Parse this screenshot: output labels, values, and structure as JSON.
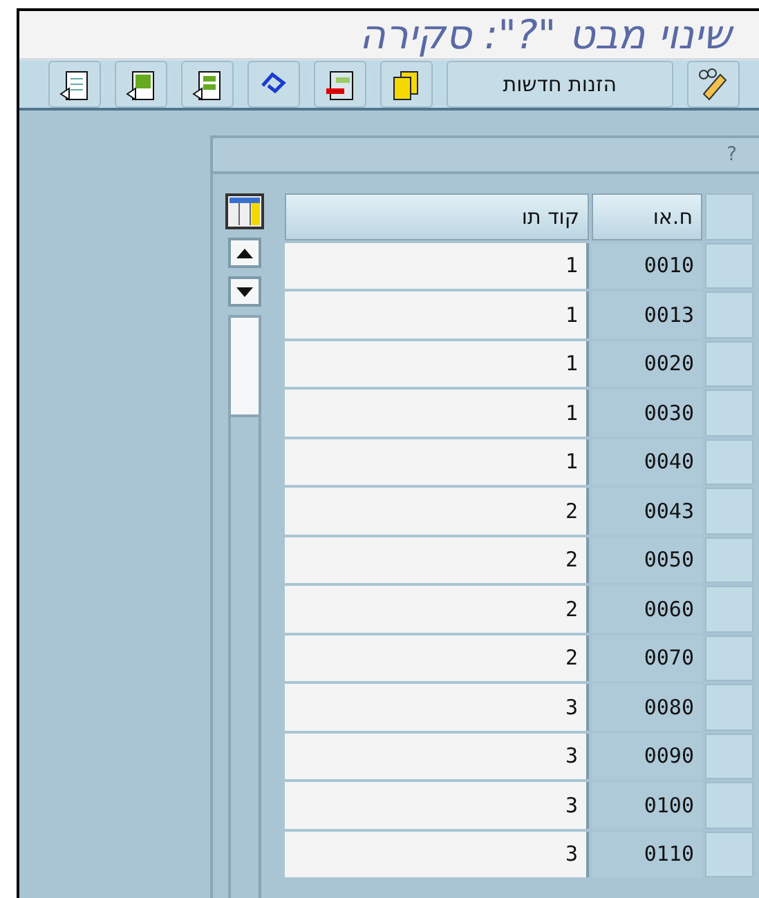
{
  "window": {
    "title": "שינוי מבט \"?\": סקירה"
  },
  "toolbar": [
    {
      "kind": "icon"
    },
    {
      "kind": "text",
      "label": "הזנות חדשות"
    },
    {
      "kind": "icon"
    },
    {
      "kind": "icon"
    },
    {
      "kind": "icon"
    },
    {
      "kind": "icon"
    },
    {
      "kind": "icon"
    },
    {
      "kind": "icon"
    }
  ],
  "panel": {
    "title": "?"
  },
  "table": {
    "columns": [
      "ח.או",
      "קוד תו"
    ],
    "rows": [
      {
        "number": "0010",
        "code": "1"
      },
      {
        "number": "0013",
        "code": "1"
      },
      {
        "number": "0020",
        "code": "1"
      },
      {
        "number": "0030",
        "code": "1"
      },
      {
        "number": "0040",
        "code": "1"
      },
      {
        "number": "0043",
        "code": "2"
      },
      {
        "number": "0050",
        "code": "2"
      },
      {
        "number": "0060",
        "code": "2"
      },
      {
        "number": "0070",
        "code": "2"
      },
      {
        "number": "0080",
        "code": "3"
      },
      {
        "number": "0090",
        "code": "3"
      },
      {
        "number": "0100",
        "code": "3"
      },
      {
        "number": "0110",
        "code": "3"
      }
    ]
  }
}
